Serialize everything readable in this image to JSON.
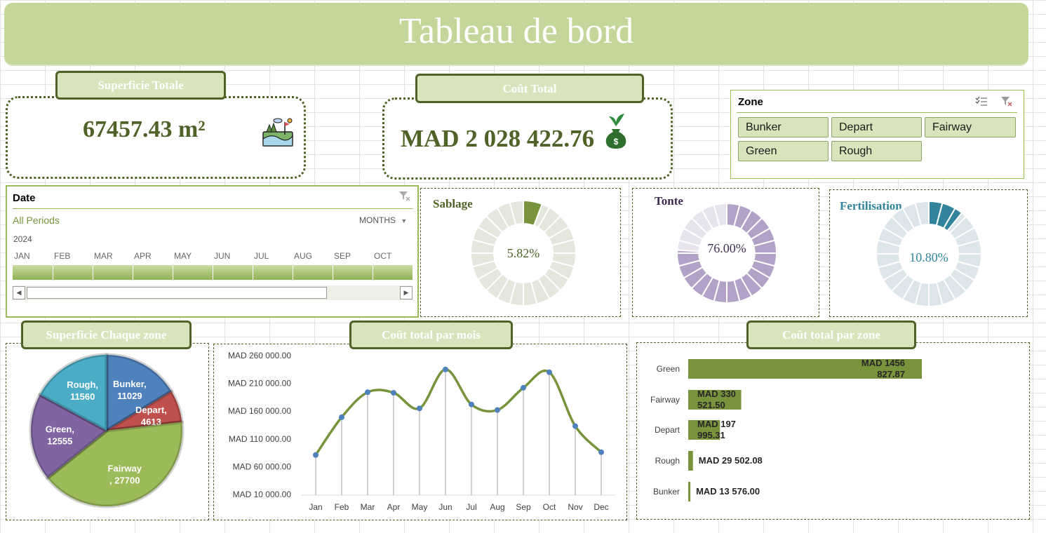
{
  "header": {
    "title": "Tableau de bord"
  },
  "kpi_area": {
    "label": "Superficie Totale",
    "value": "67457.43 m²",
    "icon": "golf-course-icon"
  },
  "kpi_cost": {
    "label": "Coût Total",
    "value": "MAD 2 028 422.76",
    "icon": "money-bag-icon"
  },
  "zone_slicer": {
    "title": "Zone",
    "items": [
      "Bunker",
      "Depart",
      "Fairway",
      "Green",
      "Rough"
    ],
    "icons": [
      "multi-select-icon",
      "clear-filter-icon"
    ]
  },
  "date_slicer": {
    "title": "Date",
    "period_label": "All Periods",
    "level": "MONTHS",
    "year": "2024",
    "months": [
      "JAN",
      "FEB",
      "MAR",
      "APR",
      "MAY",
      "JUN",
      "JUL",
      "AUG",
      "SEP",
      "OCT"
    ]
  },
  "donuts": [
    {
      "title": "Sablage",
      "value_text": "5.82%",
      "percent": 5.82,
      "color": "#77933c",
      "track": "#e3e7dc",
      "title_color": "#4f6228",
      "value_color": "#4f6228"
    },
    {
      "title": "Tonte",
      "value_text": "76.00%",
      "percent": 76.0,
      "color": "#b3a2c7",
      "track": "#e8e4ee",
      "title_color": "#3d2a4f",
      "value_color": "#403152"
    },
    {
      "title": "Fertilisation",
      "value_text": "10.80%",
      "percent": 10.8,
      "color": "#31849b",
      "track": "#dbe5ea",
      "title_color": "#31849b",
      "value_color": "#31849b"
    }
  ],
  "pie_panel": {
    "label": "Superficie Chaque zone"
  },
  "line_panel": {
    "label": "Coût  total par mois"
  },
  "bar_panel": {
    "label": "Coût  total par zone"
  },
  "chart_data": [
    {
      "type": "pie",
      "categories": [
        "Bunker",
        "Depart",
        "Fairway",
        "Green",
        "Rough"
      ],
      "values": [
        11029,
        4613,
        27700,
        12555,
        11560
      ],
      "data_labels": [
        [
          "Bunker,",
          "11029"
        ],
        [
          "Depart,",
          "4613"
        ],
        [
          "Fairway",
          ", 27700"
        ],
        [
          "Green,",
          "12555"
        ],
        [
          "Rough,",
          "11560"
        ]
      ],
      "colors": [
        "#4f81bd",
        "#c0504d",
        "#9bbb59",
        "#8064a2",
        "#4bacc6"
      ]
    },
    {
      "type": "line",
      "categories": [
        "Jan",
        "Feb",
        "Mar",
        "Apr",
        "May",
        "Jun",
        "Jul",
        "Aug",
        "Sep",
        "Oct",
        "Nov",
        "Dec"
      ],
      "values": [
        81000,
        149000,
        194000,
        193000,
        165000,
        235000,
        172000,
        162000,
        202000,
        230000,
        133000,
        86000
      ],
      "y_ticks": [
        "MAD 10 000.00",
        "MAD 60 000.00",
        "MAD 110 000.00",
        "MAD 160 000.00",
        "MAD 210 000.00",
        "MAD 260 000.00"
      ],
      "y_tick_values": [
        10000,
        60000,
        110000,
        160000,
        210000,
        260000
      ],
      "ylim": [
        10000,
        260000
      ],
      "line_color": "#77933c",
      "marker_color": "#4f81bd"
    },
    {
      "type": "bar",
      "orientation": "horizontal",
      "categories": [
        "Green",
        "Fairway",
        "Depart",
        "Rough",
        "Bunker"
      ],
      "values": [
        1456827.87,
        330521.5,
        197995.31,
        29502.08,
        13576.0
      ],
      "data_labels": [
        [
          "MAD 1456",
          "827.87"
        ],
        [
          "MAD 330",
          "521.50"
        ],
        [
          "MAD 197",
          "995.31"
        ],
        [
          "MAD 29 502.08"
        ],
        [
          "MAD 13 576.00"
        ]
      ],
      "bar_color": "#77933c"
    }
  ]
}
